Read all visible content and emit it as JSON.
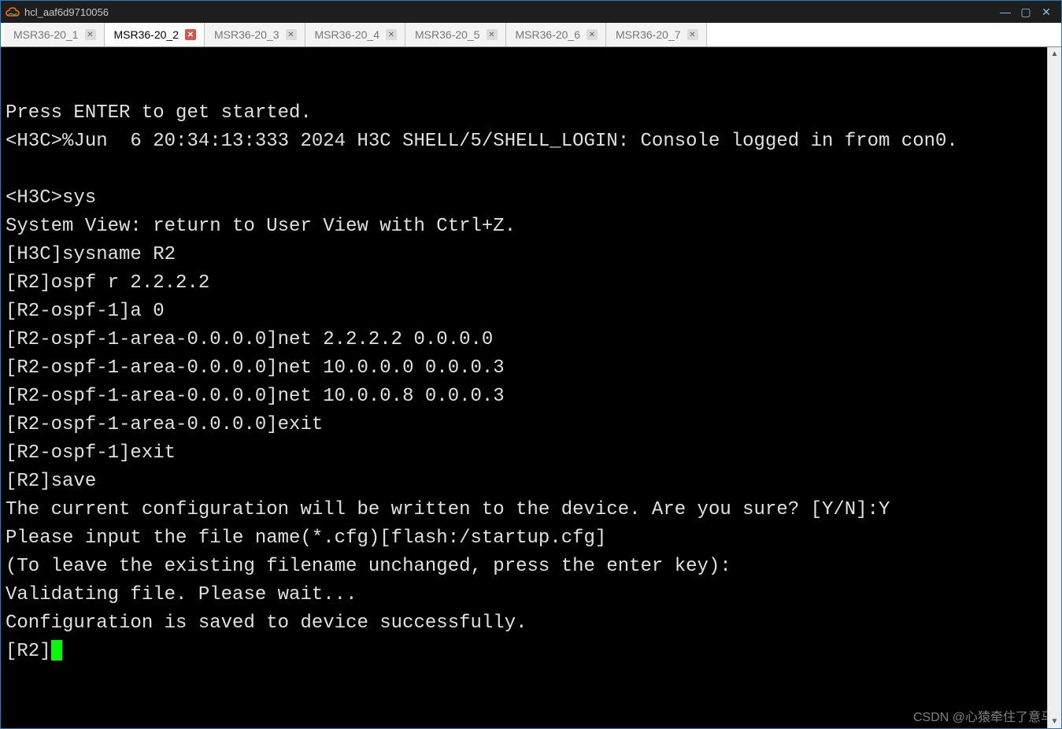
{
  "window": {
    "title": "hcl_aaf6d9710056"
  },
  "tabs": [
    {
      "label": "MSR36-20_1",
      "dirty": false,
      "active": false
    },
    {
      "label": "MSR36-20_2",
      "dirty": true,
      "active": true
    },
    {
      "label": "MSR36-20_3",
      "dirty": false,
      "active": false
    },
    {
      "label": "MSR36-20_4",
      "dirty": false,
      "active": false
    },
    {
      "label": "MSR36-20_5",
      "dirty": false,
      "active": false
    },
    {
      "label": "MSR36-20_6",
      "dirty": false,
      "active": false
    },
    {
      "label": "MSR36-20_7",
      "dirty": false,
      "active": false
    }
  ],
  "terminal": {
    "lines": [
      "",
      "Press ENTER to get started.",
      "<H3C>%Jun  6 20:34:13:333 2024 H3C SHELL/5/SHELL_LOGIN: Console logged in from con0.",
      "",
      "<H3C>sys",
      "System View: return to User View with Ctrl+Z.",
      "[H3C]sysname R2",
      "[R2]ospf r 2.2.2.2",
      "[R2-ospf-1]a 0",
      "[R2-ospf-1-area-0.0.0.0]net 2.2.2.2 0.0.0.0",
      "[R2-ospf-1-area-0.0.0.0]net 10.0.0.0 0.0.0.3",
      "[R2-ospf-1-area-0.0.0.0]net 10.0.0.8 0.0.0.3",
      "[R2-ospf-1-area-0.0.0.0]exit",
      "[R2-ospf-1]exit",
      "[R2]save",
      "The current configuration will be written to the device. Are you sure? [Y/N]:Y",
      "Please input the file name(*.cfg)[flash:/startup.cfg]",
      "(To leave the existing filename unchanged, press the enter key):",
      "Validating file. Please wait...",
      "Configuration is saved to device successfully."
    ],
    "prompt": "[R2]"
  },
  "watermark": "CSDN @心猿牵住了意马",
  "glyphs": {
    "close_x": "✕",
    "scroll_up": "▲",
    "scroll_down": "▼"
  }
}
